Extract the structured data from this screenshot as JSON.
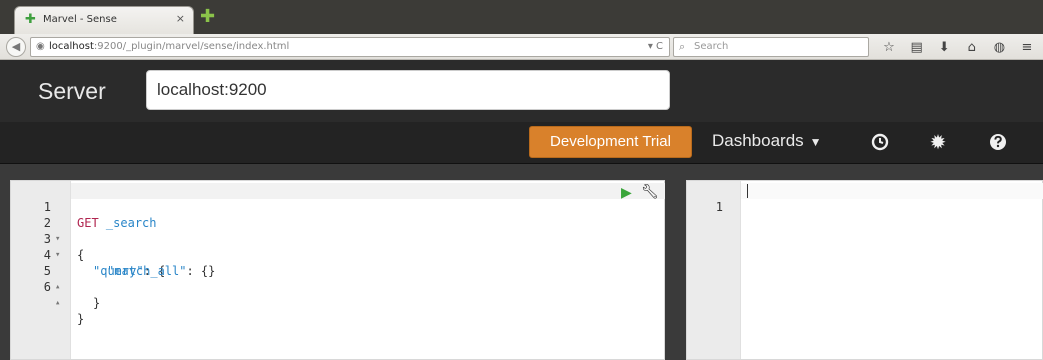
{
  "browser": {
    "tab_title": "Marvel - Sense",
    "tab_close": "×",
    "url_host": "localhost",
    "url_path": ":9200/_plugin/marvel/sense/index.html",
    "url_reload": "▾ C",
    "search_placeholder": "Search",
    "toolbar_icons": [
      "star-icon",
      "library-icon",
      "download-icon",
      "home-icon",
      "chat-icon",
      "menu-icon"
    ]
  },
  "header": {
    "server_label": "Server",
    "server_value": "localhost:9200",
    "trial_button": "Development Trial",
    "dashboards_label": "Dashboards",
    "accent_color": "#d9812b"
  },
  "editor": {
    "request_lines": [
      {
        "n": "1",
        "fold": "",
        "method": "GET",
        "path": "_search",
        "text": ""
      },
      {
        "n": "2",
        "fold": "▾",
        "text": "{"
      },
      {
        "n": "3",
        "fold": "▾",
        "key": "\"query\"",
        "text": ": {"
      },
      {
        "n": "4",
        "fold": "",
        "key": "\"match_all\"",
        "text": ": {}"
      },
      {
        "n": "5",
        "fold": "▴",
        "text": "}"
      },
      {
        "n": "6",
        "fold": "▴",
        "text": "}"
      }
    ],
    "response_line_number": "1"
  }
}
